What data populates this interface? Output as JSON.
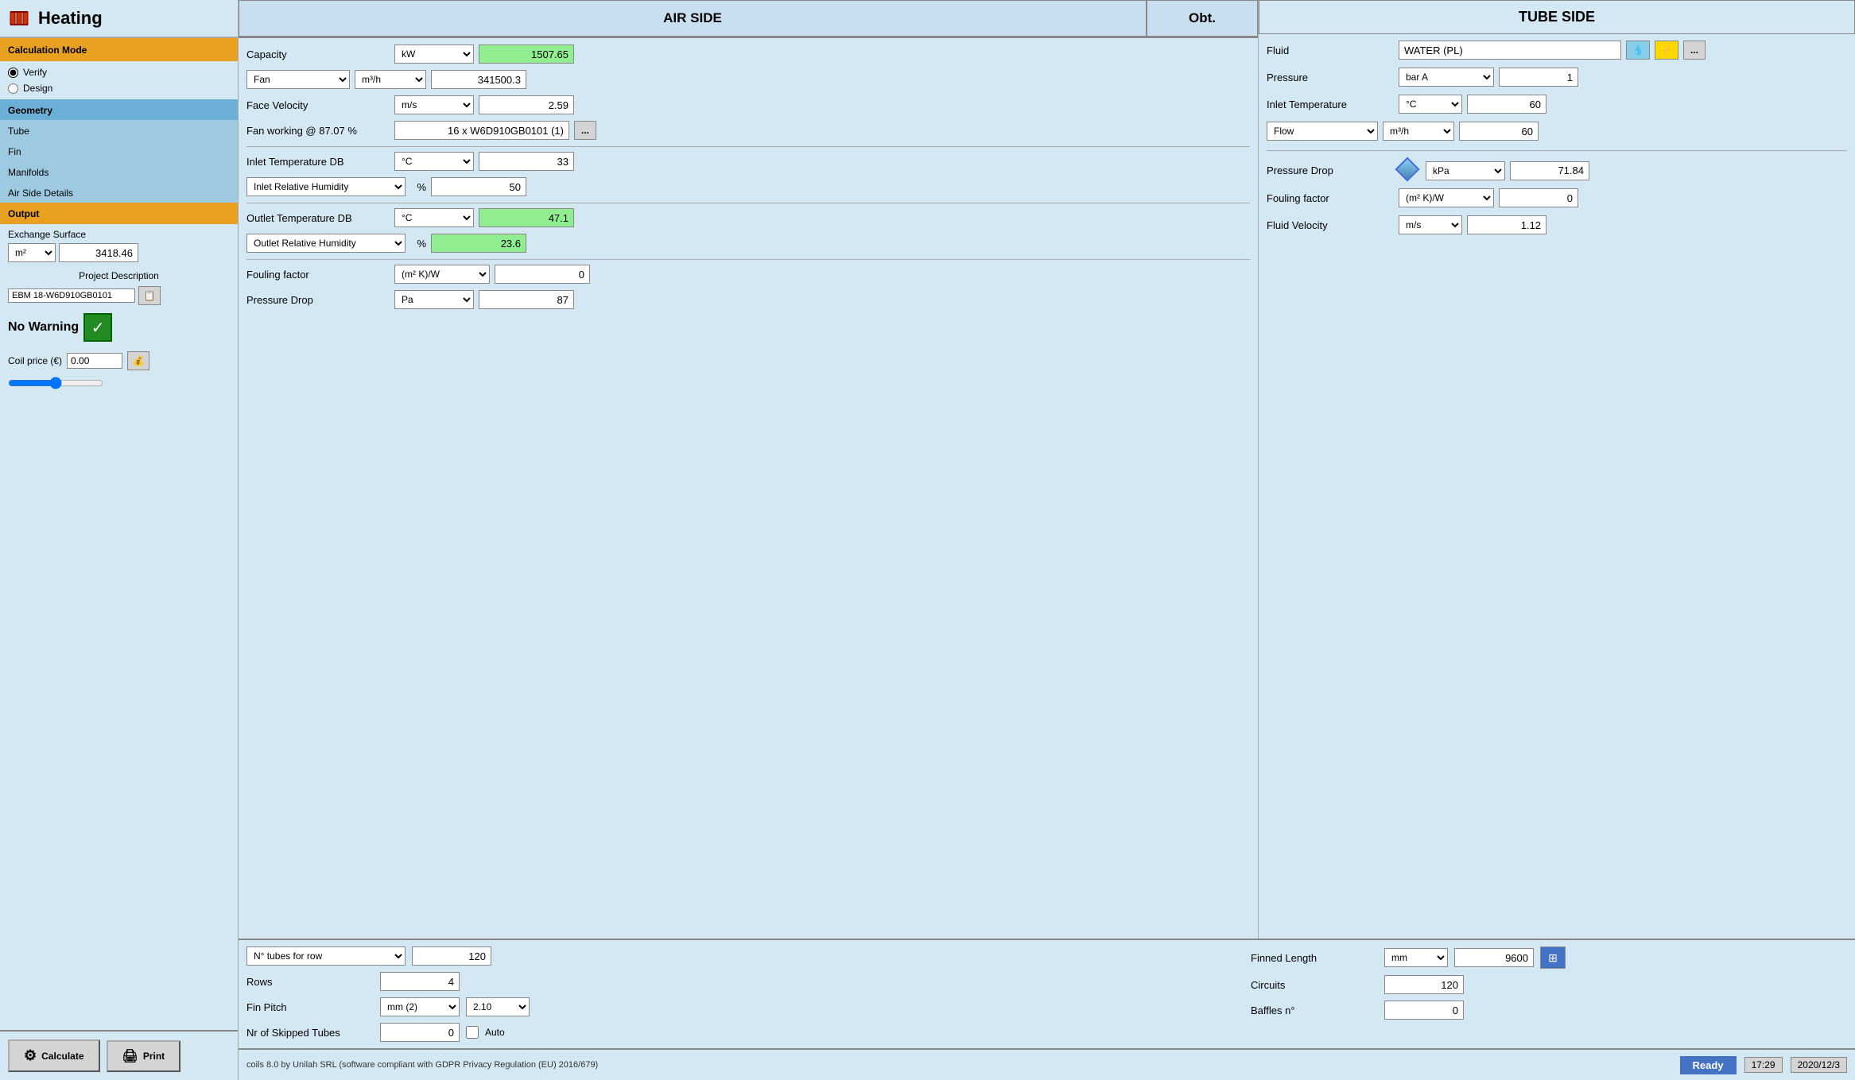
{
  "sidebar": {
    "title": "Heating",
    "calculation_mode_label": "Calculation Mode",
    "verify_label": "Verify",
    "design_label": "Design",
    "geometry_label": "Geometry",
    "tube_label": "Tube",
    "fin_label": "Fin",
    "manifolds_label": "Manifolds",
    "air_side_details_label": "Air Side Details",
    "output_label": "Output",
    "exchange_surface_label": "Exchange Surface",
    "exchange_unit": "m²",
    "exchange_value": "3418.46",
    "project_description_label": "Project Description",
    "project_value": "EBM 18-W6D910GB0101",
    "warning_label": "No Warning",
    "coil_price_label": "Coil price (€)",
    "coil_price_value": "0.00",
    "calculate_label": "Calculate",
    "print_label": "Print"
  },
  "air_side": {
    "header": "AIR SIDE",
    "obt_header": "Obt.",
    "capacity_label": "Capacity",
    "capacity_unit": "kW",
    "capacity_value": "1507.65",
    "fan_label": "Fan",
    "fan_unit": "m³/h",
    "fan_value": "341500.3",
    "face_velocity_label": "Face Velocity",
    "face_velocity_unit": "m/s",
    "face_velocity_value": "2.59",
    "fan_working_label": "Fan working @ 87.07 %",
    "fan_working_value": "16 x W6D910GB0101 (1)",
    "inlet_temp_db_label": "Inlet Temperature DB",
    "inlet_temp_db_unit": "°C",
    "inlet_temp_db_value": "33",
    "inlet_rel_humidity_label": "Inlet Relative Humidity",
    "inlet_rel_humidity_unit": "%",
    "inlet_rel_humidity_value": "50",
    "outlet_temp_db_label": "Outlet Temperature DB",
    "outlet_temp_db_unit": "°C",
    "outlet_temp_db_value": "47.1",
    "outlet_rel_humidity_label": "Outlet Relative Humidity",
    "outlet_rel_humidity_unit": "%",
    "outlet_rel_humidity_value": "23.6",
    "fouling_factor_label": "Fouling factor",
    "fouling_factor_unit": "(m² K)/W",
    "fouling_factor_value": "0",
    "pressure_drop_label": "Pressure Drop",
    "pressure_drop_unit": "Pa",
    "pressure_drop_value": "87"
  },
  "tube_side": {
    "header": "TUBE SIDE",
    "fluid_label": "Fluid",
    "fluid_value": "WATER (PL)",
    "pressure_label": "Pressure",
    "pressure_unit": "bar A",
    "pressure_value": "1",
    "inlet_temp_label": "Inlet Temperature",
    "inlet_temp_unit": "°C",
    "inlet_temp_value": "60",
    "flow_label": "Flow",
    "flow_unit": "m³/h",
    "flow_value": "60",
    "pressure_drop_label": "Pressure Drop",
    "pressure_drop_unit": "kPa",
    "pressure_drop_value": "71.84",
    "fouling_factor_label": "Fouling factor",
    "fouling_factor_unit": "(m² K)/W",
    "fouling_factor_value": "0",
    "fluid_velocity_label": "Fluid Velocity",
    "fluid_velocity_unit": "m/s",
    "fluid_velocity_value": "1.12"
  },
  "bottom_panel": {
    "tubes_for_row_label": "N° tubes for row",
    "tubes_for_row_value": "120",
    "rows_label": "Rows",
    "rows_value": "4",
    "fin_pitch_label": "Fin Pitch",
    "fin_pitch_unit": "mm (2)",
    "fin_pitch_value": "2.10",
    "nr_skipped_label": "Nr of Skipped Tubes",
    "nr_skipped_value": "0",
    "auto_label": "Auto",
    "finned_length_label": "Finned Length",
    "finned_length_unit": "mm",
    "finned_length_value": "9600",
    "circuits_label": "Circuits",
    "circuits_value": "120",
    "baffles_label": "Baffles n°",
    "baffles_value": "0"
  },
  "status_bar": {
    "text": "coils 8.0 by Unilah SRL (software compliant with GDPR Privacy Regulation (EU) 2016/679)",
    "ready": "Ready",
    "time": "17:29",
    "date": "2020/12/3"
  }
}
